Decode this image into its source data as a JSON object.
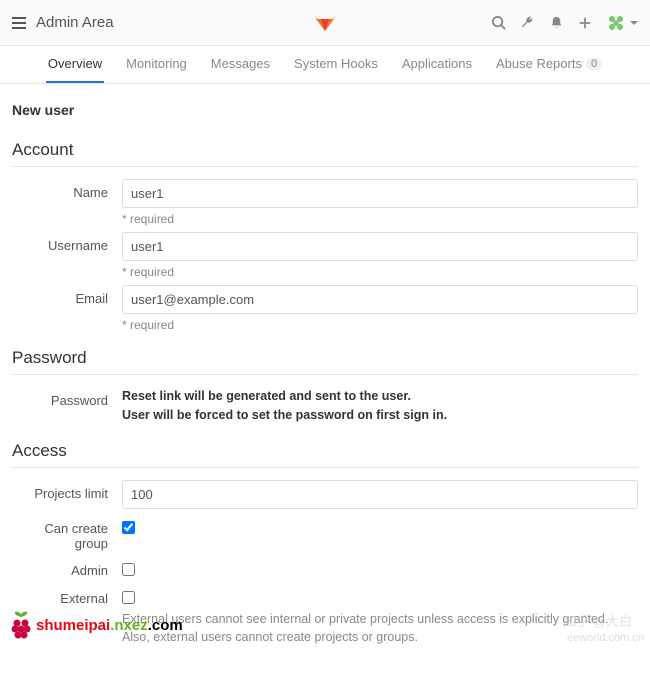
{
  "header": {
    "title": "Admin Area"
  },
  "tabs": [
    {
      "label": "Overview",
      "active": true
    },
    {
      "label": "Monitoring"
    },
    {
      "label": "Messages"
    },
    {
      "label": "System Hooks"
    },
    {
      "label": "Applications"
    },
    {
      "label": "Abuse Reports",
      "badge": "0"
    }
  ],
  "page": {
    "heading": "New user"
  },
  "sections": {
    "account": {
      "title": "Account",
      "name_label": "Name",
      "name_value": "user1",
      "username_label": "Username",
      "username_value": "user1",
      "email_label": "Email",
      "email_value": "user1@example.com",
      "required_text": "* required"
    },
    "password": {
      "title": "Password",
      "label": "Password",
      "line1": "Reset link will be generated and sent to the user.",
      "line2": "User will be forced to set the password on first sign in."
    },
    "access": {
      "title": "Access",
      "projects_limit_label": "Projects limit",
      "projects_limit_value": "100",
      "can_create_group_label": "Can create group",
      "can_create_group_checked": true,
      "admin_label": "Admin",
      "admin_checked": false,
      "external_label": "External",
      "external_checked": false,
      "external_help": "External users cannot see internal or private projects unless access is explicitly granted. Also, external users cannot create projects or groups."
    }
  },
  "footer": {
    "brand_p1": "shumeipai",
    "brand_p2": ".nxez",
    "brand_p3": ".com",
    "watermark": "知乎 @大白",
    "watermark2": "eeworld.com.cn"
  }
}
